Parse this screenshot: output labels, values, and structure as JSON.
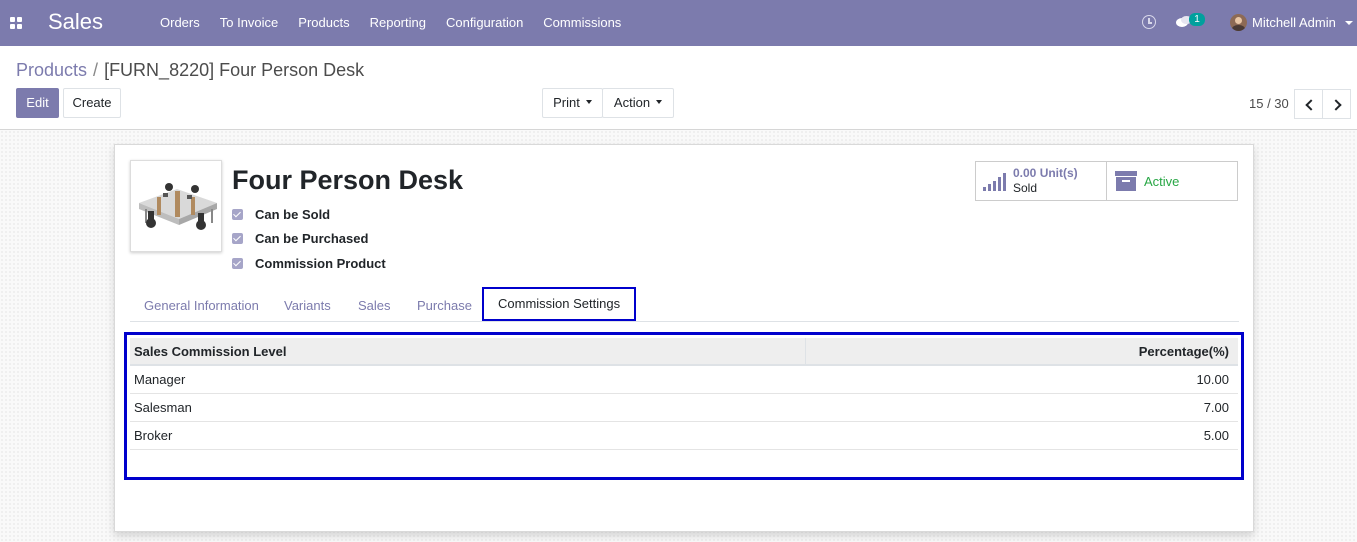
{
  "navbar": {
    "app_title": "Sales",
    "menu": [
      "Orders",
      "To Invoice",
      "Products",
      "Reporting",
      "Configuration",
      "Commissions"
    ],
    "message_count": "1",
    "user_name": "Mitchell Admin"
  },
  "breadcrumb": {
    "parent": "Products",
    "separator": "/",
    "current": "[FURN_8220] Four Person Desk"
  },
  "buttons": {
    "edit": "Edit",
    "create": "Create",
    "print": "Print",
    "action": "Action"
  },
  "pager": {
    "value": "15 / 30"
  },
  "product": {
    "name": "Four Person Desk",
    "can_be_sold": "Can be Sold",
    "can_be_purchased": "Can be Purchased",
    "commission_product": "Commission Product"
  },
  "stats": {
    "sold_value": "0.00 Unit(s)",
    "sold_label": "Sold",
    "active_label": "Active"
  },
  "tabs": [
    "General Information",
    "Variants",
    "Sales",
    "Purchase",
    "Commission Settings"
  ],
  "commission_table": {
    "columns": [
      "Sales Commission Level",
      "Percentage(%)"
    ],
    "rows": [
      {
        "level": "Manager",
        "percentage": "10.00"
      },
      {
        "level": "Salesman",
        "percentage": "7.00"
      },
      {
        "level": "Broker",
        "percentage": "5.00"
      }
    ]
  },
  "colors": {
    "brand": "#7c7bad",
    "active_green": "#28a745",
    "highlight_blue": "#0000cc",
    "badge_teal": "#00a09d"
  }
}
